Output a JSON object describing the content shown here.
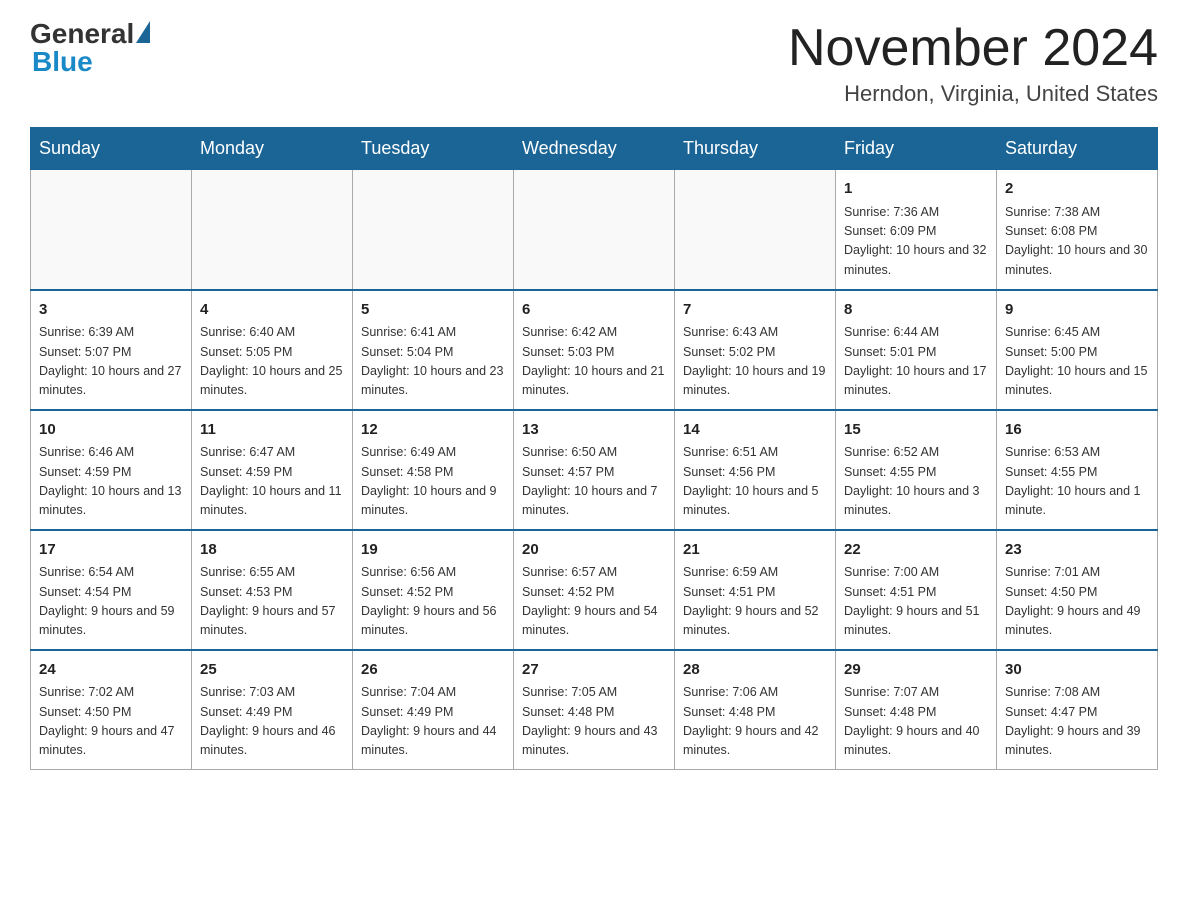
{
  "header": {
    "logo_general": "General",
    "logo_blue": "Blue",
    "month_title": "November 2024",
    "location": "Herndon, Virginia, United States"
  },
  "days_of_week": [
    "Sunday",
    "Monday",
    "Tuesday",
    "Wednesday",
    "Thursday",
    "Friday",
    "Saturday"
  ],
  "weeks": [
    [
      {
        "day": "",
        "sunrise": "",
        "sunset": "",
        "daylight": ""
      },
      {
        "day": "",
        "sunrise": "",
        "sunset": "",
        "daylight": ""
      },
      {
        "day": "",
        "sunrise": "",
        "sunset": "",
        "daylight": ""
      },
      {
        "day": "",
        "sunrise": "",
        "sunset": "",
        "daylight": ""
      },
      {
        "day": "",
        "sunrise": "",
        "sunset": "",
        "daylight": ""
      },
      {
        "day": "1",
        "sunrise": "Sunrise: 7:36 AM",
        "sunset": "Sunset: 6:09 PM",
        "daylight": "Daylight: 10 hours and 32 minutes."
      },
      {
        "day": "2",
        "sunrise": "Sunrise: 7:38 AM",
        "sunset": "Sunset: 6:08 PM",
        "daylight": "Daylight: 10 hours and 30 minutes."
      }
    ],
    [
      {
        "day": "3",
        "sunrise": "Sunrise: 6:39 AM",
        "sunset": "Sunset: 5:07 PM",
        "daylight": "Daylight: 10 hours and 27 minutes."
      },
      {
        "day": "4",
        "sunrise": "Sunrise: 6:40 AM",
        "sunset": "Sunset: 5:05 PM",
        "daylight": "Daylight: 10 hours and 25 minutes."
      },
      {
        "day": "5",
        "sunrise": "Sunrise: 6:41 AM",
        "sunset": "Sunset: 5:04 PM",
        "daylight": "Daylight: 10 hours and 23 minutes."
      },
      {
        "day": "6",
        "sunrise": "Sunrise: 6:42 AM",
        "sunset": "Sunset: 5:03 PM",
        "daylight": "Daylight: 10 hours and 21 minutes."
      },
      {
        "day": "7",
        "sunrise": "Sunrise: 6:43 AM",
        "sunset": "Sunset: 5:02 PM",
        "daylight": "Daylight: 10 hours and 19 minutes."
      },
      {
        "day": "8",
        "sunrise": "Sunrise: 6:44 AM",
        "sunset": "Sunset: 5:01 PM",
        "daylight": "Daylight: 10 hours and 17 minutes."
      },
      {
        "day": "9",
        "sunrise": "Sunrise: 6:45 AM",
        "sunset": "Sunset: 5:00 PM",
        "daylight": "Daylight: 10 hours and 15 minutes."
      }
    ],
    [
      {
        "day": "10",
        "sunrise": "Sunrise: 6:46 AM",
        "sunset": "Sunset: 4:59 PM",
        "daylight": "Daylight: 10 hours and 13 minutes."
      },
      {
        "day": "11",
        "sunrise": "Sunrise: 6:47 AM",
        "sunset": "Sunset: 4:59 PM",
        "daylight": "Daylight: 10 hours and 11 minutes."
      },
      {
        "day": "12",
        "sunrise": "Sunrise: 6:49 AM",
        "sunset": "Sunset: 4:58 PM",
        "daylight": "Daylight: 10 hours and 9 minutes."
      },
      {
        "day": "13",
        "sunrise": "Sunrise: 6:50 AM",
        "sunset": "Sunset: 4:57 PM",
        "daylight": "Daylight: 10 hours and 7 minutes."
      },
      {
        "day": "14",
        "sunrise": "Sunrise: 6:51 AM",
        "sunset": "Sunset: 4:56 PM",
        "daylight": "Daylight: 10 hours and 5 minutes."
      },
      {
        "day": "15",
        "sunrise": "Sunrise: 6:52 AM",
        "sunset": "Sunset: 4:55 PM",
        "daylight": "Daylight: 10 hours and 3 minutes."
      },
      {
        "day": "16",
        "sunrise": "Sunrise: 6:53 AM",
        "sunset": "Sunset: 4:55 PM",
        "daylight": "Daylight: 10 hours and 1 minute."
      }
    ],
    [
      {
        "day": "17",
        "sunrise": "Sunrise: 6:54 AM",
        "sunset": "Sunset: 4:54 PM",
        "daylight": "Daylight: 9 hours and 59 minutes."
      },
      {
        "day": "18",
        "sunrise": "Sunrise: 6:55 AM",
        "sunset": "Sunset: 4:53 PM",
        "daylight": "Daylight: 9 hours and 57 minutes."
      },
      {
        "day": "19",
        "sunrise": "Sunrise: 6:56 AM",
        "sunset": "Sunset: 4:52 PM",
        "daylight": "Daylight: 9 hours and 56 minutes."
      },
      {
        "day": "20",
        "sunrise": "Sunrise: 6:57 AM",
        "sunset": "Sunset: 4:52 PM",
        "daylight": "Daylight: 9 hours and 54 minutes."
      },
      {
        "day": "21",
        "sunrise": "Sunrise: 6:59 AM",
        "sunset": "Sunset: 4:51 PM",
        "daylight": "Daylight: 9 hours and 52 minutes."
      },
      {
        "day": "22",
        "sunrise": "Sunrise: 7:00 AM",
        "sunset": "Sunset: 4:51 PM",
        "daylight": "Daylight: 9 hours and 51 minutes."
      },
      {
        "day": "23",
        "sunrise": "Sunrise: 7:01 AM",
        "sunset": "Sunset: 4:50 PM",
        "daylight": "Daylight: 9 hours and 49 minutes."
      }
    ],
    [
      {
        "day": "24",
        "sunrise": "Sunrise: 7:02 AM",
        "sunset": "Sunset: 4:50 PM",
        "daylight": "Daylight: 9 hours and 47 minutes."
      },
      {
        "day": "25",
        "sunrise": "Sunrise: 7:03 AM",
        "sunset": "Sunset: 4:49 PM",
        "daylight": "Daylight: 9 hours and 46 minutes."
      },
      {
        "day": "26",
        "sunrise": "Sunrise: 7:04 AM",
        "sunset": "Sunset: 4:49 PM",
        "daylight": "Daylight: 9 hours and 44 minutes."
      },
      {
        "day": "27",
        "sunrise": "Sunrise: 7:05 AM",
        "sunset": "Sunset: 4:48 PM",
        "daylight": "Daylight: 9 hours and 43 minutes."
      },
      {
        "day": "28",
        "sunrise": "Sunrise: 7:06 AM",
        "sunset": "Sunset: 4:48 PM",
        "daylight": "Daylight: 9 hours and 42 minutes."
      },
      {
        "day": "29",
        "sunrise": "Sunrise: 7:07 AM",
        "sunset": "Sunset: 4:48 PM",
        "daylight": "Daylight: 9 hours and 40 minutes."
      },
      {
        "day": "30",
        "sunrise": "Sunrise: 7:08 AM",
        "sunset": "Sunset: 4:47 PM",
        "daylight": "Daylight: 9 hours and 39 minutes."
      }
    ]
  ]
}
